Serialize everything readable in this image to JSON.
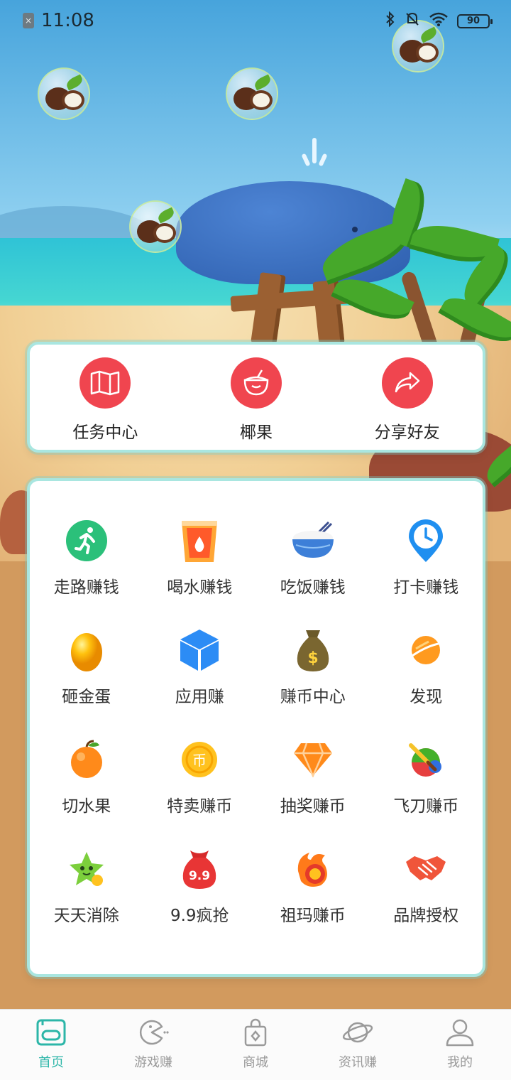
{
  "status_bar": {
    "time": "11:08",
    "sim_icon": "sim-off-icon",
    "icons": [
      "bluetooth-icon",
      "mute-icon",
      "wifi-icon"
    ],
    "battery": "90"
  },
  "quick_actions": [
    {
      "label": "任务中心",
      "icon": "map-icon"
    },
    {
      "label": "椰果",
      "icon": "coconut-drink-icon"
    },
    {
      "label": "分享好友",
      "icon": "share-icon"
    }
  ],
  "features": [
    {
      "label": "走路赚钱",
      "icon": "running-icon"
    },
    {
      "label": "喝水赚钱",
      "icon": "water-cup-icon"
    },
    {
      "label": "吃饭赚钱",
      "icon": "rice-bowl-icon"
    },
    {
      "label": "打卡赚钱",
      "icon": "clock-pin-icon"
    },
    {
      "label": "砸金蛋",
      "icon": "golden-egg-icon"
    },
    {
      "label": "应用赚",
      "icon": "cube-icon"
    },
    {
      "label": "赚币中心",
      "icon": "money-bag-icon"
    },
    {
      "label": "发现",
      "icon": "planet-icon"
    },
    {
      "label": "切水果",
      "icon": "orange-icon"
    },
    {
      "label": "特卖赚币",
      "icon": "coin-icon"
    },
    {
      "label": "抽奖赚币",
      "icon": "diamond-icon"
    },
    {
      "label": "飞刀赚币",
      "icon": "fruit-knife-icon"
    },
    {
      "label": "天天消除",
      "icon": "star-character-icon"
    },
    {
      "label": "9.9疯抢",
      "icon": "red-bag-icon",
      "badge": "9.9"
    },
    {
      "label": "祖玛赚币",
      "icon": "fire-coin-icon"
    },
    {
      "label": "品牌授权",
      "icon": "handshake-icon"
    }
  ],
  "tabbar": {
    "tabs": [
      {
        "label": "首页",
        "icon": "home-icon",
        "active": true
      },
      {
        "label": "游戏赚",
        "icon": "game-icon",
        "active": false
      },
      {
        "label": "商城",
        "icon": "shop-bag-icon",
        "active": false
      },
      {
        "label": "资讯赚",
        "icon": "planet-outline-icon",
        "active": false
      },
      {
        "label": "我的",
        "icon": "user-icon",
        "active": false
      }
    ]
  },
  "colors": {
    "accent": "#f0454f",
    "tab_active": "#2cb6a8",
    "card_border": "#a9e6e0"
  }
}
